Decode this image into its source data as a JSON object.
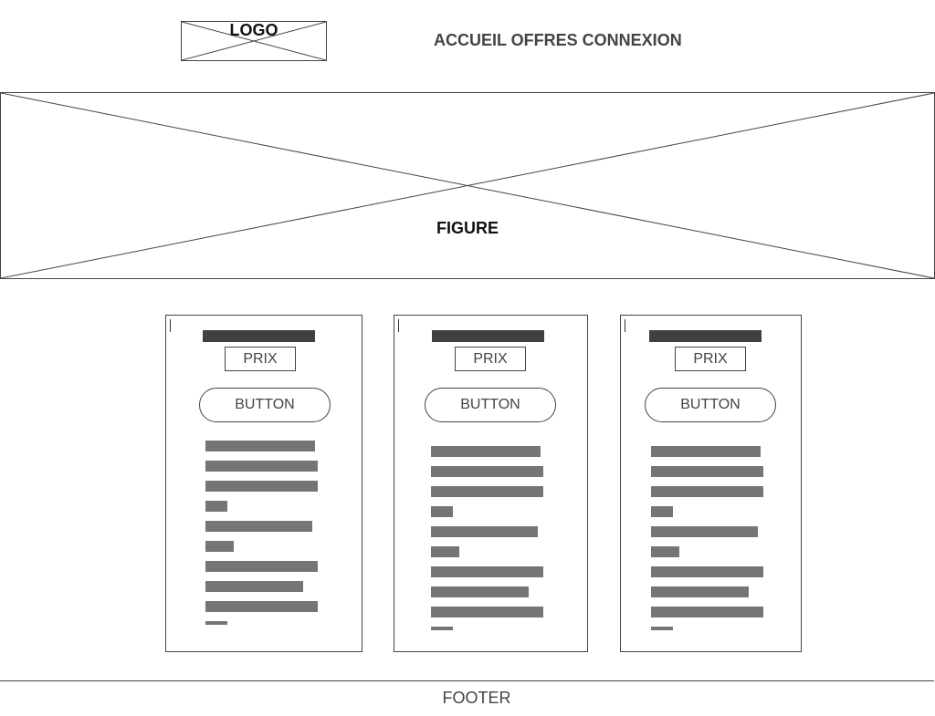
{
  "header": {
    "logo_label": "LOGO",
    "nav_text": "ACCUEIL OFFRES CONNEXION"
  },
  "hero": {
    "label": "FIGURE"
  },
  "cards": [
    {
      "price_label": "PRIX",
      "button_label": "BUTTON"
    },
    {
      "price_label": "PRIX",
      "button_label": "BUTTON"
    },
    {
      "price_label": "PRIX",
      "button_label": "BUTTON"
    }
  ],
  "footer": {
    "label": "FOOTER"
  }
}
